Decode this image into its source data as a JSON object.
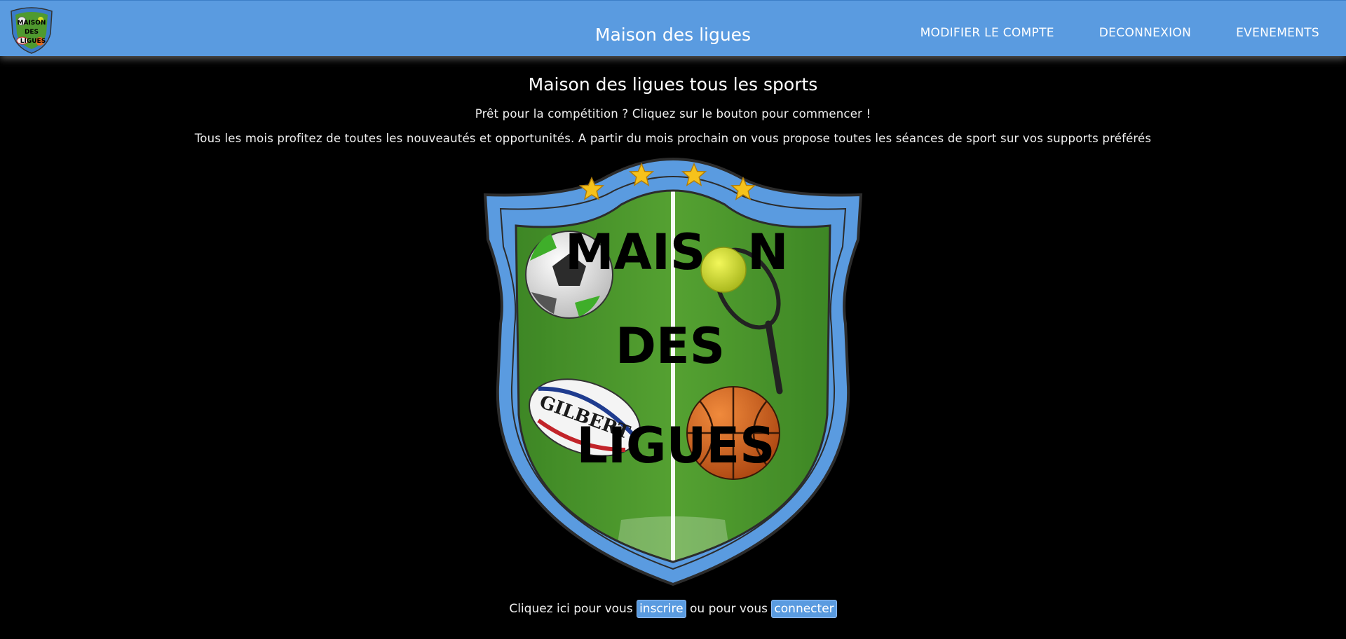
{
  "header": {
    "logo_text": [
      "MAISON",
      "DES",
      "LIGUES"
    ],
    "title": "Maison des ligues",
    "nav": [
      {
        "label": "MODIFIER LE COMPTE"
      },
      {
        "label": "DECONNEXION"
      },
      {
        "label": "EVENEMENTS"
      }
    ]
  },
  "main": {
    "headline": "Maison des ligues tous les sports",
    "subtitle": "Prêt pour la compétition ? Cliquez sur le bouton pour commencer !",
    "description": "Tous les mois profitez de toutes les nouveautés et opportunités. A partir du mois prochain on vous propose toutes les séances de sport sur vos supports préférés",
    "crest": {
      "line1": "MAIS",
      "line1_end": "N",
      "line2": "DES",
      "line3": "LIGUES",
      "rugby_brand": "GILBERT"
    },
    "cta": {
      "prefix": "Cliquez ici pour vous",
      "register_label": "inscrire",
      "middle": "ou pour vous",
      "login_label": "connecter"
    }
  },
  "colors": {
    "header_bg": "#5a9be0",
    "page_bg": "#000000",
    "crest_blue": "#5a9be0",
    "grass": "#4f9a2f"
  }
}
